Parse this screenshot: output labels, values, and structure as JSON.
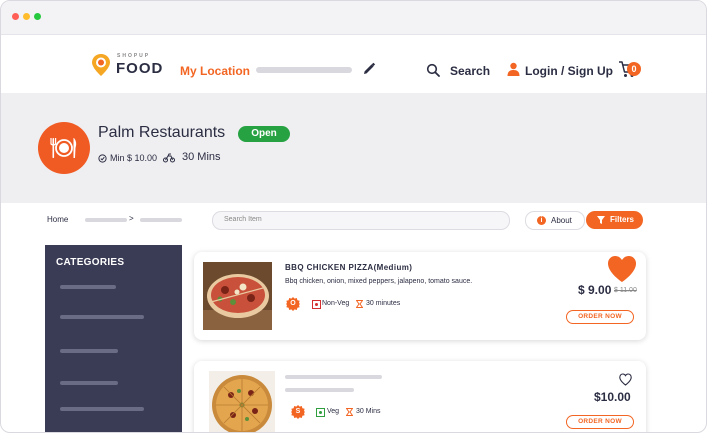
{
  "header": {
    "logo_small": "SHOPUP",
    "logo_big": "FOOD",
    "my_location": "My Location",
    "search": "Search",
    "login": "Login / Sign Up",
    "cart_count": "0"
  },
  "restaurant": {
    "name": "Palm Restaurants",
    "status": "Open",
    "min_order": "Min $ 10.00",
    "delivery_time": "30 Mins"
  },
  "toolbar": {
    "home": "Home",
    "sep": ">",
    "search_placeholder": "Search Item",
    "about": "About",
    "filters": "Filters"
  },
  "sidebar": {
    "title": "CATEGORIES"
  },
  "items": [
    {
      "title": "BBQ CHICKEN PIZZA(Medium)",
      "description": "Bbq chicken, onion, mixed peppers, jalapeno, tomato sauce.",
      "badge": "O",
      "type": "Non-Veg",
      "time": "30 minutes",
      "price": "$ 9.00",
      "old_price": "$ 11.00",
      "order": "ORDER NOW",
      "favorited": true
    },
    {
      "badge": "S",
      "type": "Veg",
      "time": "30 Mins",
      "price": "$10.00",
      "order": "ORDER NOW",
      "favorited": false
    }
  ],
  "colors": {
    "accent": "#f26522",
    "open": "#27a243",
    "sidebar": "#3a3b55",
    "non_veg": "#d32f2f",
    "veg": "#2e9e3e"
  }
}
